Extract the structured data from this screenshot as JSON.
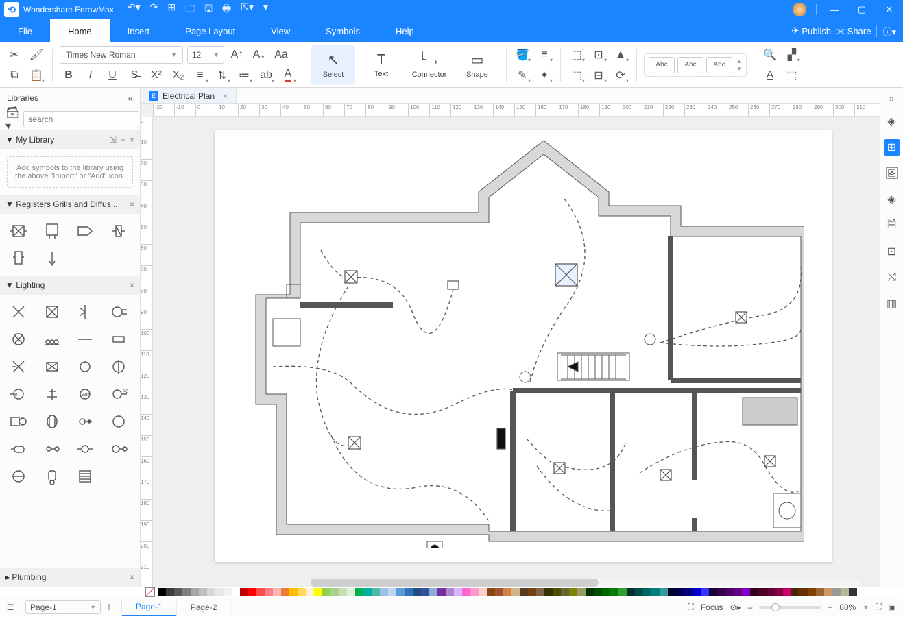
{
  "title": "Wondershare EdrawMax",
  "menu": {
    "file": "File",
    "home": "Home",
    "insert": "Insert",
    "page_layout": "Page Layout",
    "view": "View",
    "symbols": "Symbols",
    "help": "Help",
    "publish": "Publish",
    "share": "Share"
  },
  "ribbon": {
    "font": "Times New Roman",
    "size": "12",
    "select": "Select",
    "text": "Text",
    "connector": "Connector",
    "shape": "Shape",
    "style_chip": "Abc"
  },
  "libraries": {
    "title": "Libraries",
    "search_placeholder": "search",
    "my_library": "My Library",
    "my_library_hint": "Add symbols to the library using the above \"Import\" or \"Add\" icon.",
    "registers": "Registers Grills and Diffus...",
    "lighting": "Lighting",
    "plumbing": "Plumbing"
  },
  "document": {
    "tab": "Electrical Plan"
  },
  "ruler_h": [
    "-20",
    "-10",
    "0",
    "10",
    "20",
    "30",
    "40",
    "50",
    "60",
    "70",
    "80",
    "90",
    "100",
    "110",
    "120",
    "130",
    "140",
    "150",
    "160",
    "170",
    "180",
    "190",
    "200",
    "210",
    "220",
    "230",
    "240",
    "250",
    "260",
    "270",
    "280",
    "290",
    "300",
    "310"
  ],
  "ruler_v": [
    "0",
    "10",
    "20",
    "30",
    "40",
    "50",
    "60",
    "70",
    "80",
    "90",
    "100",
    "110",
    "120",
    "130",
    "140",
    "150",
    "160",
    "170",
    "180",
    "190",
    "200",
    "210"
  ],
  "status": {
    "page_select": "Page-1",
    "pages": [
      "Page-1",
      "Page-2"
    ],
    "focus": "Focus",
    "zoom": "80%"
  },
  "colors": [
    "#000000",
    "#3b3b3b",
    "#595959",
    "#7f7f7f",
    "#a5a5a5",
    "#bfbfbf",
    "#d8d8d8",
    "#e7e7e7",
    "#f2f2f2",
    "#ffffff",
    "#c00000",
    "#ff0000",
    "#ff4d4d",
    "#ff8080",
    "#ffb3b3",
    "#ed7d31",
    "#ffbf00",
    "#ffd966",
    "#fff2cc",
    "#ffff00",
    "#92d050",
    "#a9d08e",
    "#c6e0b4",
    "#e2efda",
    "#00b050",
    "#00b0a0",
    "#4db8a8",
    "#9bc2e6",
    "#bdd7ee",
    "#5b9bd5",
    "#2e75b6",
    "#1f4e78",
    "#305496",
    "#8ea9db",
    "#7030a0",
    "#b084cc",
    "#d9b3ff",
    "#ff66cc",
    "#ff99cc",
    "#ffcccc",
    "#8b4513",
    "#a0522d",
    "#cd853f",
    "#d2b48c",
    "#5a3921",
    "#704214",
    "#806040",
    "#333300",
    "#4d4d00",
    "#666633",
    "#808000",
    "#999966",
    "#003300",
    "#004d00",
    "#006600",
    "#008000",
    "#339933",
    "#003333",
    "#004d4d",
    "#006666",
    "#008080",
    "#339999",
    "#000033",
    "#00004d",
    "#000080",
    "#0000cc",
    "#3333ff",
    "#1a0033",
    "#33004d",
    "#4d0066",
    "#660080",
    "#8000cc",
    "#330019",
    "#4d0026",
    "#660033",
    "#800040",
    "#cc0066",
    "#4d2600",
    "#663300",
    "#804000",
    "#996633",
    "#cc9966",
    "#999999",
    "#b8b894",
    "#333333"
  ]
}
